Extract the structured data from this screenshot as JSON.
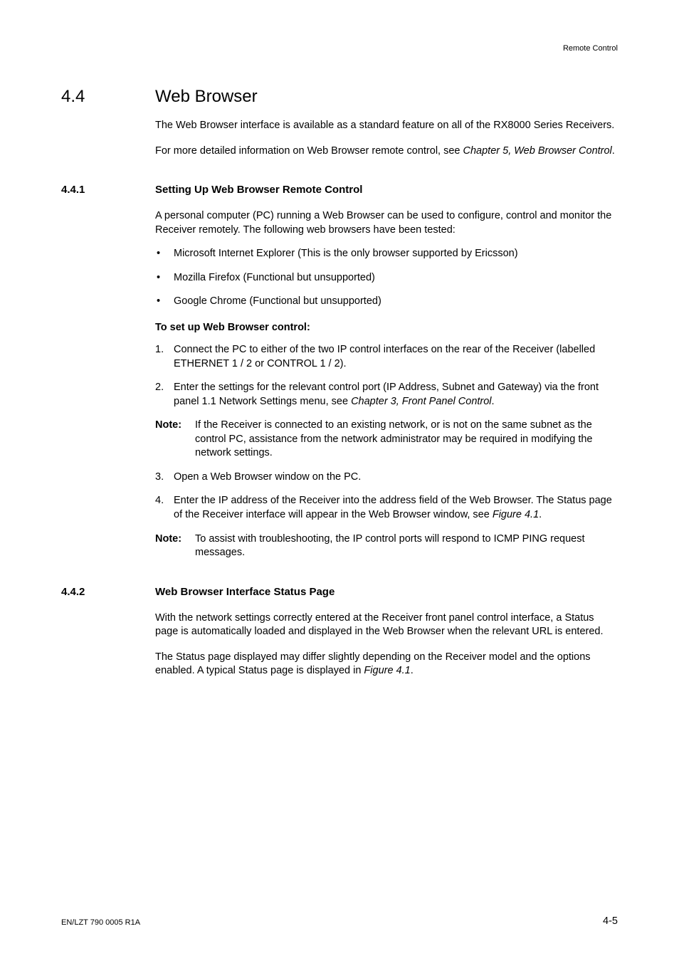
{
  "header": {
    "label": "Remote Control"
  },
  "h1": {
    "number": "4.4",
    "title": "Web Browser"
  },
  "intro": {
    "p1": "The Web Browser interface is available as a standard feature on all of the RX8000 Series Receivers.",
    "p2a": "For more detailed information on Web Browser remote control, see ",
    "p2i": "Chapter 5, Web Browser Control",
    "p2b": "."
  },
  "s441": {
    "number": "4.4.1",
    "title": "Setting Up Web Browser Remote Control",
    "p1": "A personal computer (PC) running a Web Browser can be used to configure, control and monitor the Receiver remotely. The following web browsers have been tested:",
    "bullets": [
      "Microsoft Internet Explorer (This is the only browser supported by Ericsson)",
      "Mozilla Firefox (Functional but unsupported)",
      "Google Chrome (Functional but unsupported)"
    ],
    "setup_heading": "To set up Web Browser control:",
    "steps": {
      "s1_marker": "1.",
      "s1": "Connect the PC to either of the two IP control interfaces on the rear of the Receiver (labelled ETHERNET 1 / 2 or CONTROL 1 / 2).",
      "s2_marker": "2.",
      "s2a": "Enter the settings for the relevant control port (IP Address, Subnet and Gateway) via the front panel 1.1 Network Settings menu, see ",
      "s2i": "Chapter 3, Front Panel Control",
      "s2b": ".",
      "note1_label": "Note:",
      "note1": "If the Receiver is connected to an existing network, or is not on the same subnet as the control PC, assistance from the network administrator may be required in modifying the network settings.",
      "s3_marker": "3.",
      "s3": "Open a Web Browser window on the PC.",
      "s4_marker": "4.",
      "s4a": "Enter the IP address of the Receiver into the address field of the Web Browser. The Status page of the Receiver interface will appear in the Web Browser window, see ",
      "s4i": "Figure 4.1",
      "s4b": ".",
      "note2_label": "Note:",
      "note2": "To assist with troubleshooting, the IP control ports will respond to ICMP PING request messages."
    }
  },
  "s442": {
    "number": "4.4.2",
    "title": "Web Browser Interface Status Page",
    "p1": "With the network settings correctly entered at the Receiver front panel control interface, a Status page is automatically loaded and displayed in the Web Browser when the relevant URL is entered.",
    "p2a": "The Status page displayed may differ slightly depending on the Receiver model and the options enabled. A typical Status page is displayed in ",
    "p2i": "Figure 4.1",
    "p2b": "."
  },
  "footer": {
    "left": "EN/LZT 790 0005 R1A",
    "right": "4-5"
  }
}
